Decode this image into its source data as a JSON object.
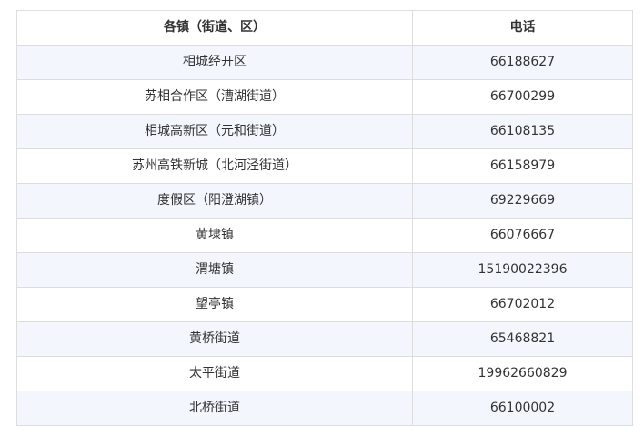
{
  "table": {
    "headers": [
      "各镇（街道、区）",
      "电话"
    ],
    "rows": [
      {
        "name": "相城经开区",
        "phone": "66188627"
      },
      {
        "name": "苏相合作区（漕湖街道）",
        "phone": "66700299"
      },
      {
        "name": "相城高新区（元和街道）",
        "phone": "66108135"
      },
      {
        "name": "苏州高铁新城（北河泾街道）",
        "phone": "66158979"
      },
      {
        "name": "度假区（阳澄湖镇）",
        "phone": "69229669"
      },
      {
        "name": "黄埭镇",
        "phone": "66076667"
      },
      {
        "name": "渭塘镇",
        "phone": "15190022396"
      },
      {
        "name": "望亭镇",
        "phone": "66702012"
      },
      {
        "name": "黄桥街道",
        "phone": "65468821"
      },
      {
        "name": "太平街道",
        "phone": "19962660829"
      },
      {
        "name": "北桥街道",
        "phone": "66100002"
      }
    ]
  }
}
